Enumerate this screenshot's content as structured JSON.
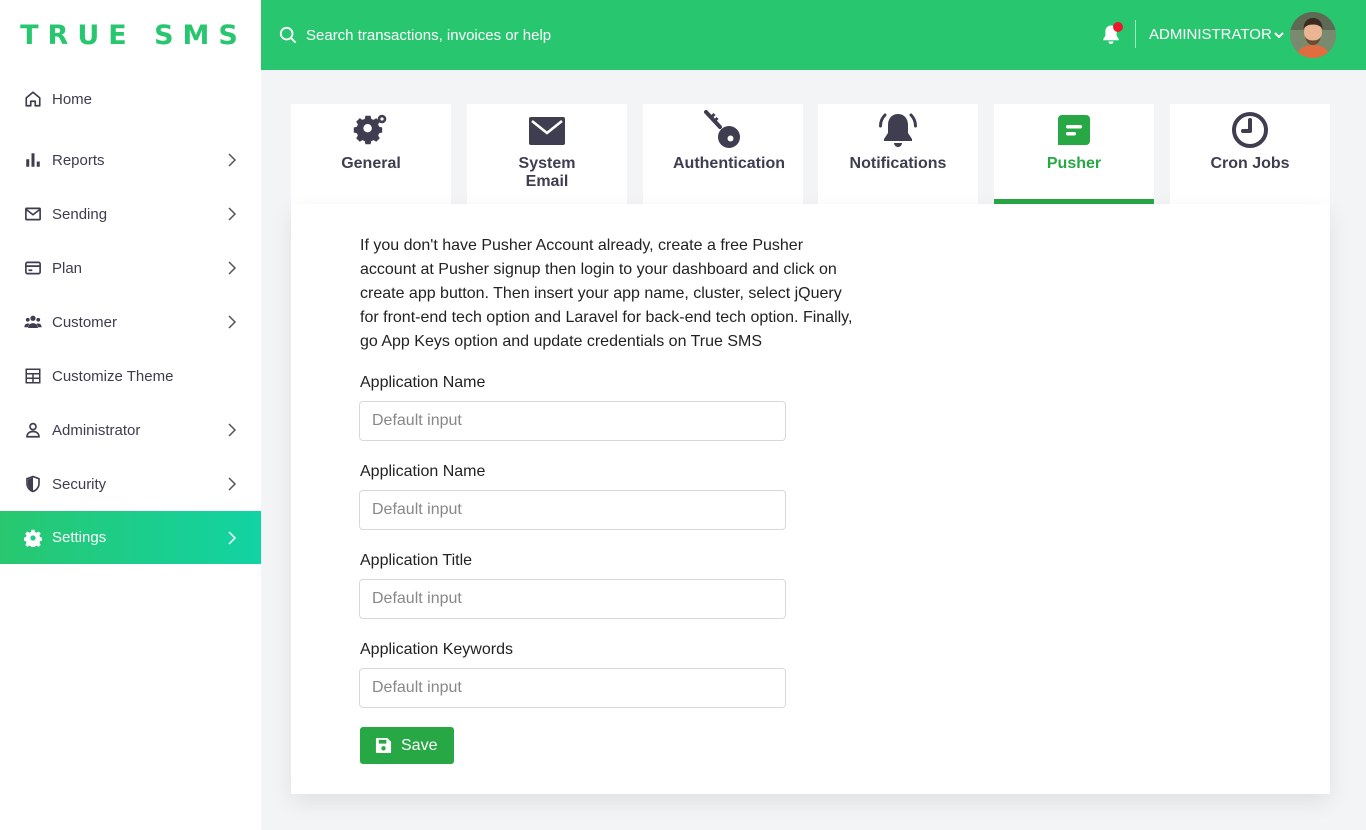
{
  "app": {
    "logo": "TRUE SMS"
  },
  "header": {
    "search_placeholder": "Search transactions, invoices or help",
    "user_name": "ADMINISTRATOR",
    "notification_dot_color": "#ea1a2c"
  },
  "sidebar": {
    "items": [
      {
        "label": "Home",
        "icon": "home-icon",
        "has_chevron": false,
        "active": false
      },
      {
        "label": "Reports",
        "icon": "bar-chart-icon",
        "has_chevron": true,
        "active": false
      },
      {
        "label": "Sending",
        "icon": "mail-icon",
        "has_chevron": true,
        "active": false
      },
      {
        "label": "Plan",
        "icon": "credit-card-icon",
        "has_chevron": true,
        "active": false
      },
      {
        "label": "Customer",
        "icon": "users-icon",
        "has_chevron": true,
        "active": false
      },
      {
        "label": "Customize Theme",
        "icon": "grid-icon",
        "has_chevron": false,
        "active": false
      },
      {
        "label": "Administrator",
        "icon": "user-icon",
        "has_chevron": true,
        "active": false
      },
      {
        "label": "Security",
        "icon": "shield-icon",
        "has_chevron": true,
        "active": false
      },
      {
        "label": "Settings",
        "icon": "gear-icon",
        "has_chevron": true,
        "active": true
      }
    ]
  },
  "tabs": [
    {
      "label": "General",
      "icon": "gear-icon",
      "active": false
    },
    {
      "label": "System Email",
      "icon": "envelope-icon",
      "active": false
    },
    {
      "label": "Authentication",
      "icon": "key-icon",
      "active": false
    },
    {
      "label": "Notifications",
      "icon": "bell-icon",
      "active": false
    },
    {
      "label": "Pusher",
      "icon": "message-icon",
      "active": true
    },
    {
      "label": "Cron Jobs",
      "icon": "clock-icon",
      "active": false
    }
  ],
  "form": {
    "intro": "If you don't have Pusher Account already, create a free Pusher account at Pusher signup then login to your dashboard and click on create app button. Then insert your app name, cluster, select jQuery for front-end tech option and Laravel for back-end tech option. Finally, go App Keys option and update credentials on True SMS",
    "fields": [
      {
        "label": "Application Name",
        "placeholder": "Default input",
        "value": ""
      },
      {
        "label": "Application Name",
        "placeholder": "Default input",
        "value": ""
      },
      {
        "label": "Application Title",
        "placeholder": "Default input",
        "value": ""
      },
      {
        "label": "Application Keywords",
        "placeholder": "Default input",
        "value": ""
      }
    ],
    "save_label": "Save"
  },
  "colors": {
    "brand": "#28c76f",
    "accent": "#28a745",
    "sidebar_active_end": "#12d3a4",
    "tab_icon": "#3e3e50"
  }
}
